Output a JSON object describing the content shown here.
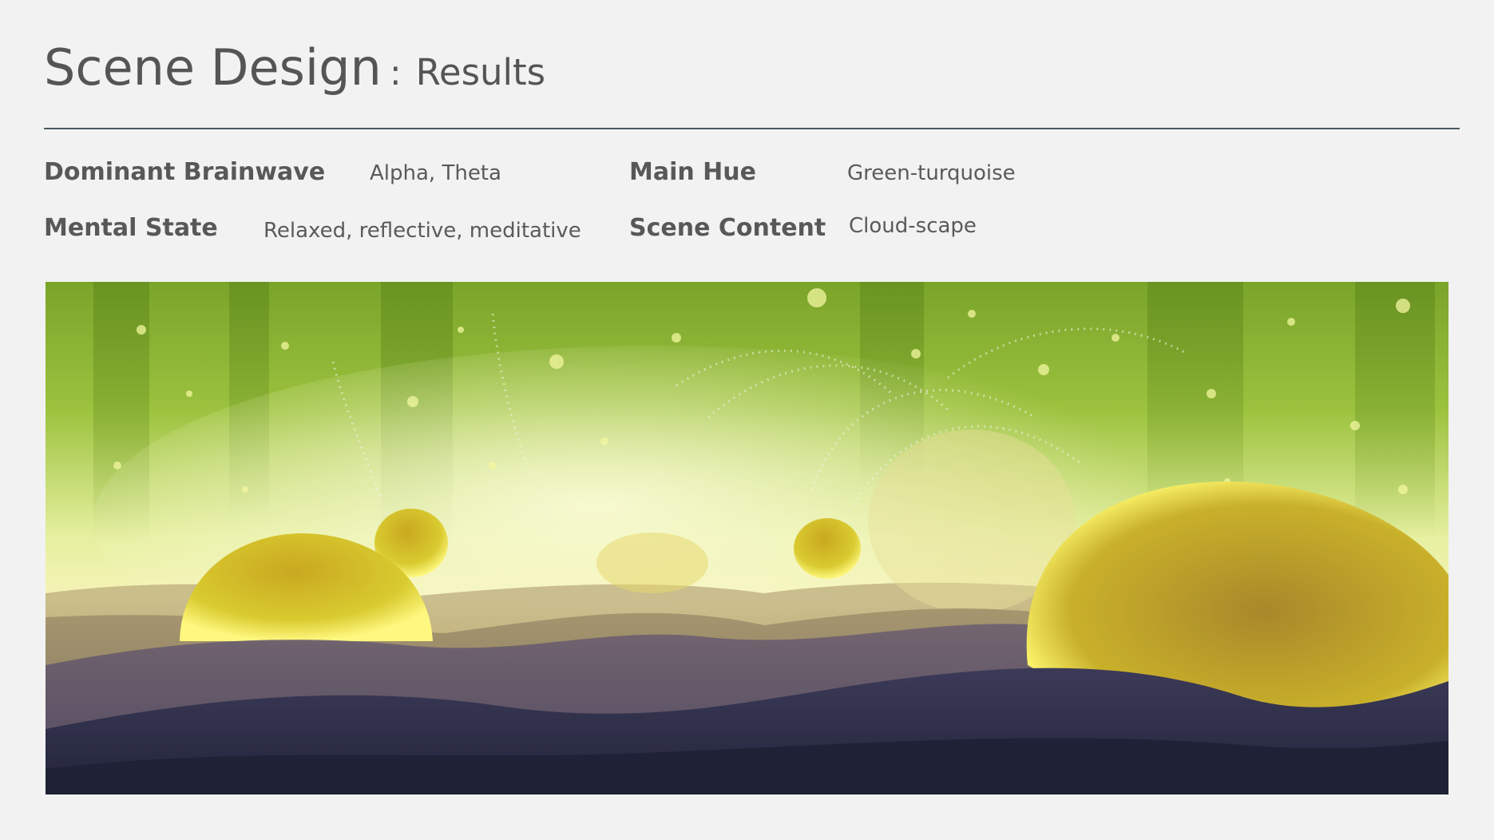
{
  "header": {
    "title": "Scene Design",
    "separator": ":",
    "subtitle": "Results"
  },
  "details": {
    "brainwave_label": "Dominant Brainwave",
    "brainwave_value": "Alpha, Theta",
    "hue_label": "Main Hue",
    "hue_value": "Green-turquoise",
    "mental_label": "Mental State",
    "mental_value": "Relaxed, reflective, meditative",
    "content_label": "Scene Content",
    "content_value": "Cloud-scape"
  },
  "colors": {
    "background": "#f2f2f2",
    "rule": "#4b5a60",
    "text": "#555555",
    "scene_sky": "#8fb83a",
    "scene_glow": "#f4f4b0",
    "orb": "#d8c828",
    "dunes_dark": "#2a2c44"
  }
}
